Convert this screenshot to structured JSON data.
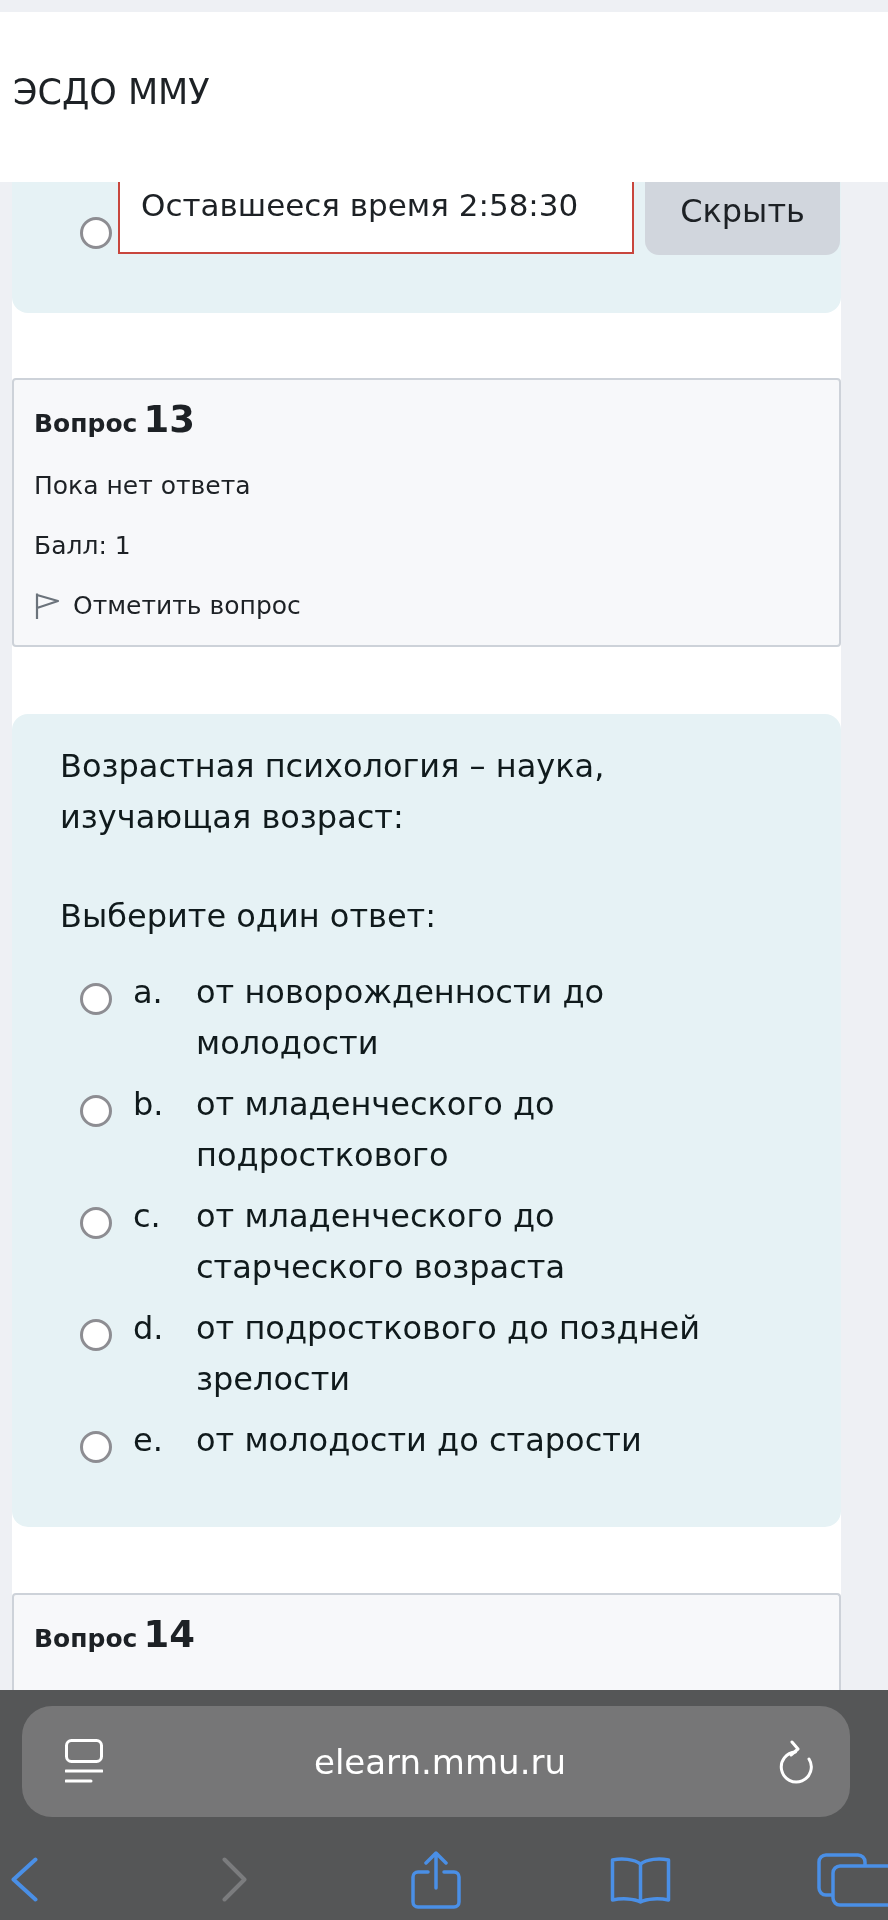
{
  "header": {
    "title": "ЭСДО ММУ"
  },
  "timer_card": {
    "radio": {
      "selected": false
    },
    "timer": "Оставшееся время 2:58:30",
    "hide_button": "Скрыть"
  },
  "question_info": {
    "label": "Вопрос",
    "number": "13",
    "status": "Пока нет ответа",
    "score": "Балл: 1",
    "flag_link": "Отметить вопрос"
  },
  "question": {
    "text": "Возрастная психология – наука, изучающая возраст:",
    "prompt": "Выберите один ответ:",
    "options": [
      {
        "letter": "a.",
        "text": "от новорожденности до молодости",
        "selected": false
      },
      {
        "letter": "b.",
        "text": "от младенческого до подросткового",
        "selected": false
      },
      {
        "letter": "c.",
        "text": "от младенческого до старческого возраста",
        "selected": false
      },
      {
        "letter": "d.",
        "text": "от подросткового до поздней зрелости",
        "selected": false
      },
      {
        "letter": "e.",
        "text": "от молодости до старости",
        "selected": false
      }
    ]
  },
  "next_question_info": {
    "label": "Вопрос",
    "number": "14"
  },
  "browser": {
    "url": "elearn.mmu.ru"
  }
}
